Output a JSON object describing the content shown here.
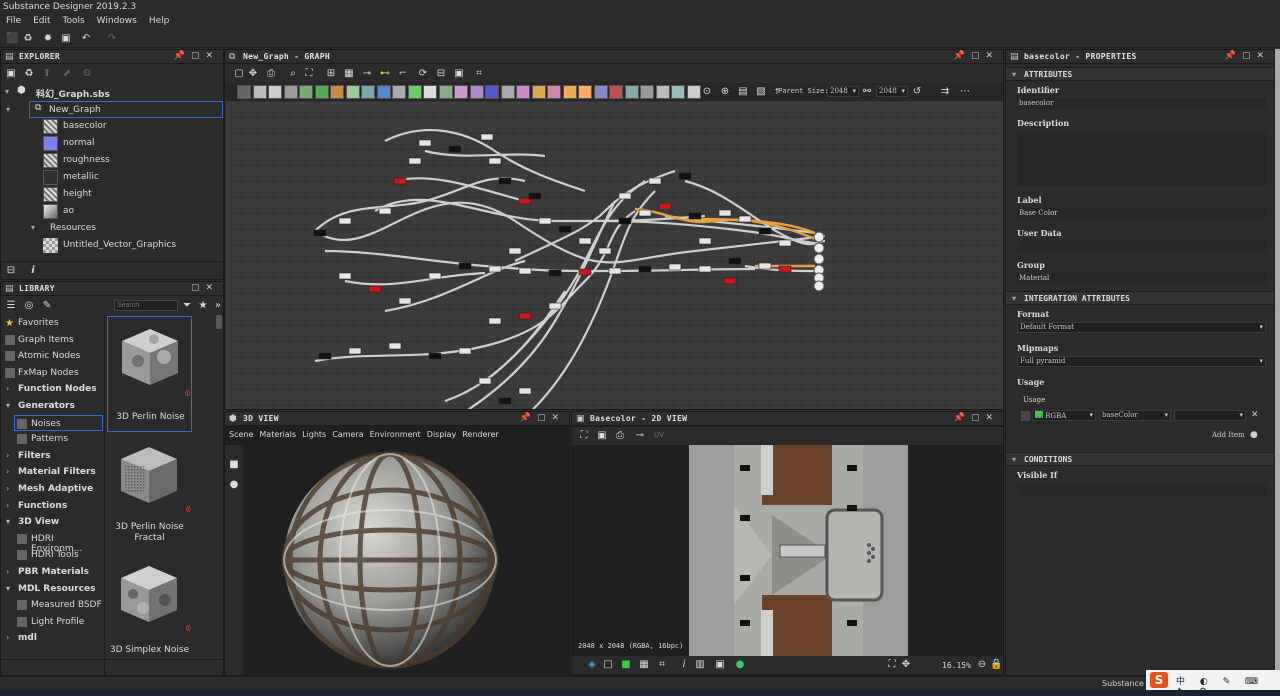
{
  "app": {
    "title": "Substance Designer 2019.2.3"
  },
  "menu": [
    "File",
    "Edit",
    "Tools",
    "Windows",
    "Help"
  ],
  "explorer": {
    "title": "EXPLORER",
    "package": "科幻_Graph.sbs",
    "graph": "New_Graph",
    "outputs": [
      "basecolor",
      "normal",
      "roughness",
      "metallic",
      "height",
      "ao"
    ],
    "resources_folder": "Resources",
    "resource_item": "Untitled_Vector_Graphics"
  },
  "library": {
    "title": "LIBRARY",
    "search_placeholder": "Search",
    "categories": [
      {
        "label": "Favorites",
        "bold": false
      },
      {
        "label": "Graph Items",
        "bold": false
      },
      {
        "label": "Atomic Nodes",
        "bold": false
      },
      {
        "label": "FxMap Nodes",
        "bold": false
      },
      {
        "label": "Function Nodes",
        "bold": true
      },
      {
        "label": "Generators",
        "bold": true
      },
      {
        "label": "Noises",
        "bold": false
      },
      {
        "label": "Patterns",
        "bold": false
      },
      {
        "label": "Filters",
        "bold": true
      },
      {
        "label": "Material Filters",
        "bold": true
      },
      {
        "label": "Mesh Adaptive",
        "bold": true
      },
      {
        "label": "Functions",
        "bold": true
      },
      {
        "label": "3D View",
        "bold": true
      },
      {
        "label": "HDRI Environm...",
        "bold": false
      },
      {
        "label": "HDRI Tools",
        "bold": false
      },
      {
        "label": "PBR Materials",
        "bold": true
      },
      {
        "label": "MDL Resources",
        "bold": true
      },
      {
        "label": "Measured BSDF",
        "bold": false
      },
      {
        "label": "Light Profile",
        "bold": false
      },
      {
        "label": "mdl",
        "bold": true
      }
    ],
    "cards": [
      "3D Perlin Noise",
      "3D Perlin Noise\nFractal",
      "3D Simplex Noise"
    ]
  },
  "graph": {
    "title": "New_Graph - GRAPH",
    "parent_size_label": "Parent Size:",
    "parent_size": "2048",
    "size2": "2048"
  },
  "view3d": {
    "title": "3D VIEW",
    "menu": [
      "Scene",
      "Materials",
      "Lights",
      "Camera",
      "Environment",
      "Display",
      "Renderer"
    ]
  },
  "view2d": {
    "title": "Basecolor - 2D VIEW",
    "uv_label": "UV",
    "info": "2048 x 2048 (RGBA, 16bpc)",
    "zoom": "16.15%"
  },
  "props": {
    "title": "basecolor - PROPERTIES",
    "section_attributes": "ATTRIBUTES",
    "identifier_label": "Identifier",
    "identifier": "basecolor",
    "description_label": "Description",
    "label_label": "Label",
    "label": "Base Color",
    "userdata_label": "User Data",
    "group_label": "Group",
    "group": "Material",
    "section_integration": "INTEGRATION ATTRIBUTES",
    "format_label": "Format",
    "format": "Default Format",
    "mipmaps_label": "Mipmaps",
    "mipmaps": "Full pyramid",
    "usage_label": "Usage",
    "usage_sub": "Usage",
    "usage_channel": "RGBA",
    "usage_value": "baseColor",
    "add_item": "Add Item",
    "section_conditions": "CONDITIONS",
    "visible_if_label": "Visible If"
  },
  "status": {
    "right_text": "Substance B"
  },
  "colors": {
    "accent": "#2f6fd1",
    "wire_orange": "#e8a23a",
    "node_red": "#d01818"
  }
}
